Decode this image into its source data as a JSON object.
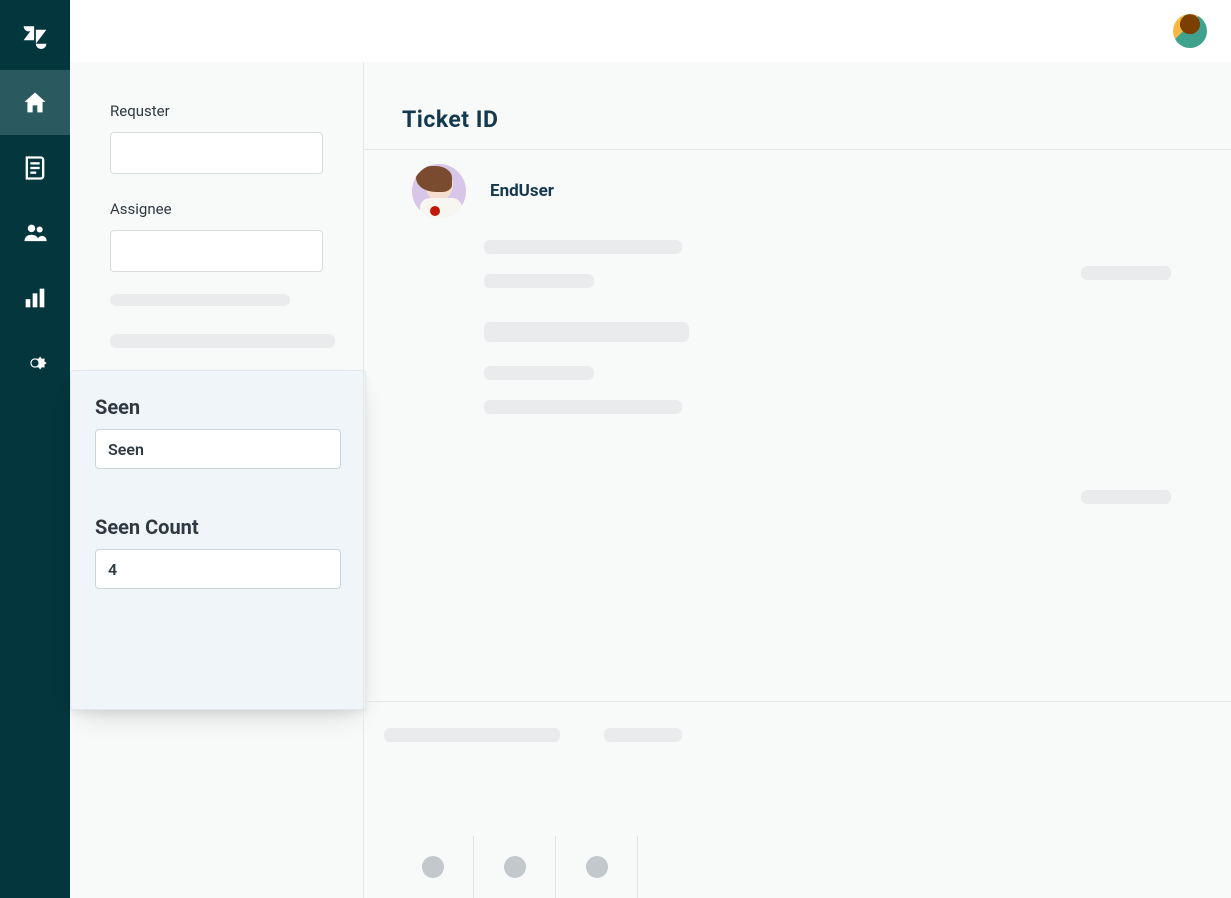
{
  "nav": {
    "items": [
      "logo",
      "home",
      "views",
      "customers",
      "reports",
      "admin"
    ],
    "active": "home"
  },
  "topbar": {
    "avatar": "agent-avatar"
  },
  "left_panel": {
    "requester_label": "Requster",
    "requester_value": "",
    "assignee_label": "Assignee",
    "assignee_value": ""
  },
  "seen_card": {
    "seen_label": "Seen",
    "seen_value": "Seen",
    "seen_count_label": "Seen Count",
    "seen_count_value": "4"
  },
  "ticket": {
    "title": "Ticket  ID",
    "enduser_name": "EndUser"
  }
}
